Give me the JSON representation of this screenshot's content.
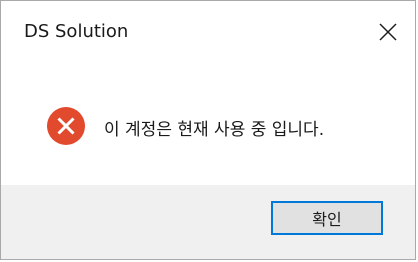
{
  "window": {
    "title": "DS Solution"
  },
  "dialog": {
    "message": "이 계정은 현재 사용 중 입니다.",
    "icon": "error-icon",
    "ok_label": "확인"
  },
  "colors": {
    "error_red": "#e24a2e",
    "focus_border": "#0078d7",
    "footer_bg": "#f0f0f0"
  }
}
